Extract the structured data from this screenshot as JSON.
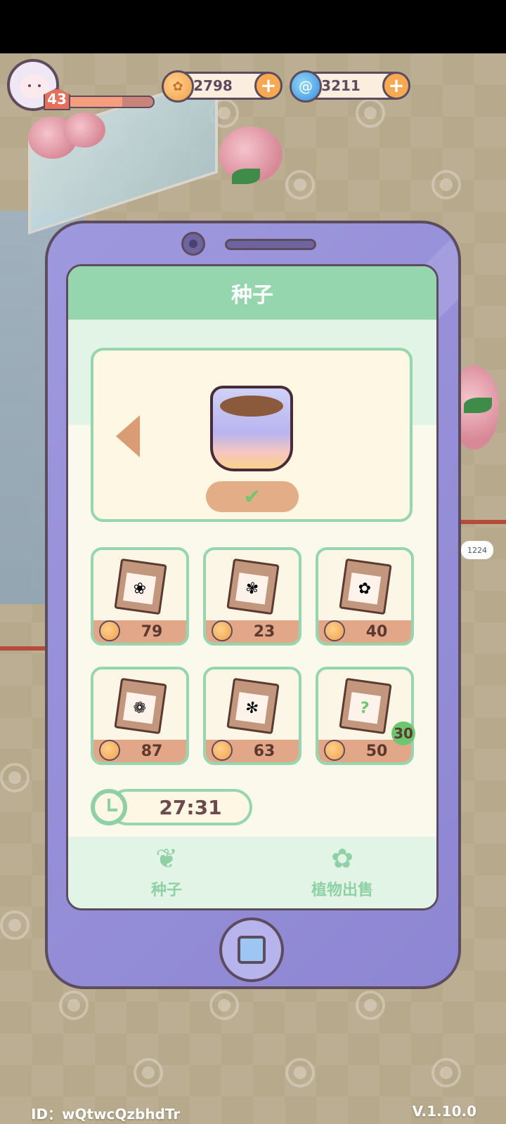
{
  "player": {
    "level": "43",
    "xp_fraction": 0.65
  },
  "currencies": {
    "coins": "2798",
    "gems": "3211",
    "add_symbol": "+"
  },
  "world": {
    "mailbox_count": "1224"
  },
  "panel": {
    "title": "种子",
    "confirm_symbol": "✔",
    "seeds": [
      {
        "price": "79",
        "icon": "red-flower-icon"
      },
      {
        "price": "23",
        "icon": "hyacinth-icon"
      },
      {
        "price": "40",
        "icon": "white-flower-icon"
      },
      {
        "price": "87",
        "icon": "rose-icon"
      },
      {
        "price": "63",
        "icon": "lily-icon"
      },
      {
        "price": "50",
        "icon": "mystery-seed-icon",
        "badge": "30"
      }
    ],
    "timer": "27:31",
    "tabs": {
      "seeds_label": "种子",
      "sell_label": "植物出售"
    }
  },
  "footer": {
    "id_text": "ID：wQtwcQzbhdTr",
    "version": "V.1.10.0"
  },
  "colors": {
    "mint": "#95d6ae",
    "phone": "#9e98de",
    "price_bar": "#e2a789"
  }
}
